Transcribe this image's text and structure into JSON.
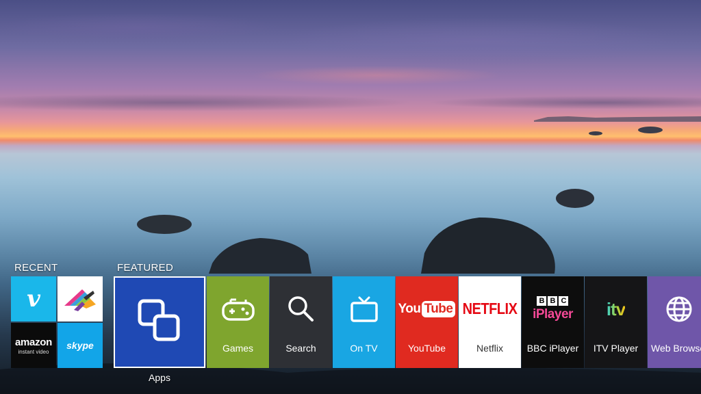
{
  "background": {
    "description": ""
  },
  "hub": {
    "recent_label": "RECENT",
    "featured_label": "FEATURED",
    "recent": [
      {
        "name": "vimeo",
        "logo_text": "v",
        "color": "#1ab7ea"
      },
      {
        "name": "channel-4",
        "logo_text": "",
        "color": "#ffffff"
      },
      {
        "name": "amazon-instant-video",
        "logo_text": "amazon",
        "logo_sub": "instant video",
        "color": "#0b0b0b"
      },
      {
        "name": "skype",
        "logo_text": "skype",
        "color": "#12a5e8"
      }
    ],
    "featured": {
      "apps": {
        "label": "Apps",
        "icon": "apps-icon",
        "color": "#1f49b4"
      },
      "games": {
        "label": "Games",
        "icon": "gamepad-icon",
        "color": "#7fa52e"
      },
      "search": {
        "label": "Search",
        "icon": "search-icon",
        "color": "#2e3035"
      },
      "ontv": {
        "label": "On TV",
        "icon": "tv-icon",
        "color": "#19a6e3"
      },
      "youtube": {
        "label": "YouTube",
        "logo_you": "You",
        "logo_tube": "Tube",
        "color": "#e02a20"
      },
      "netflix": {
        "label": "Netflix",
        "logo": "NETFLIX",
        "color": "#ffffff"
      },
      "bbc": {
        "label": "BBC iPlayer",
        "logo_letters": [
          "B",
          "B",
          "C"
        ],
        "logo_sub": "iPlayer",
        "color": "#0d0d0d"
      },
      "itv": {
        "label": "ITV Player",
        "logo": "itv",
        "color": "#151517"
      },
      "web": {
        "label": "Web Browser",
        "icon": "globe-icon",
        "color": "#6f56a9"
      }
    }
  }
}
